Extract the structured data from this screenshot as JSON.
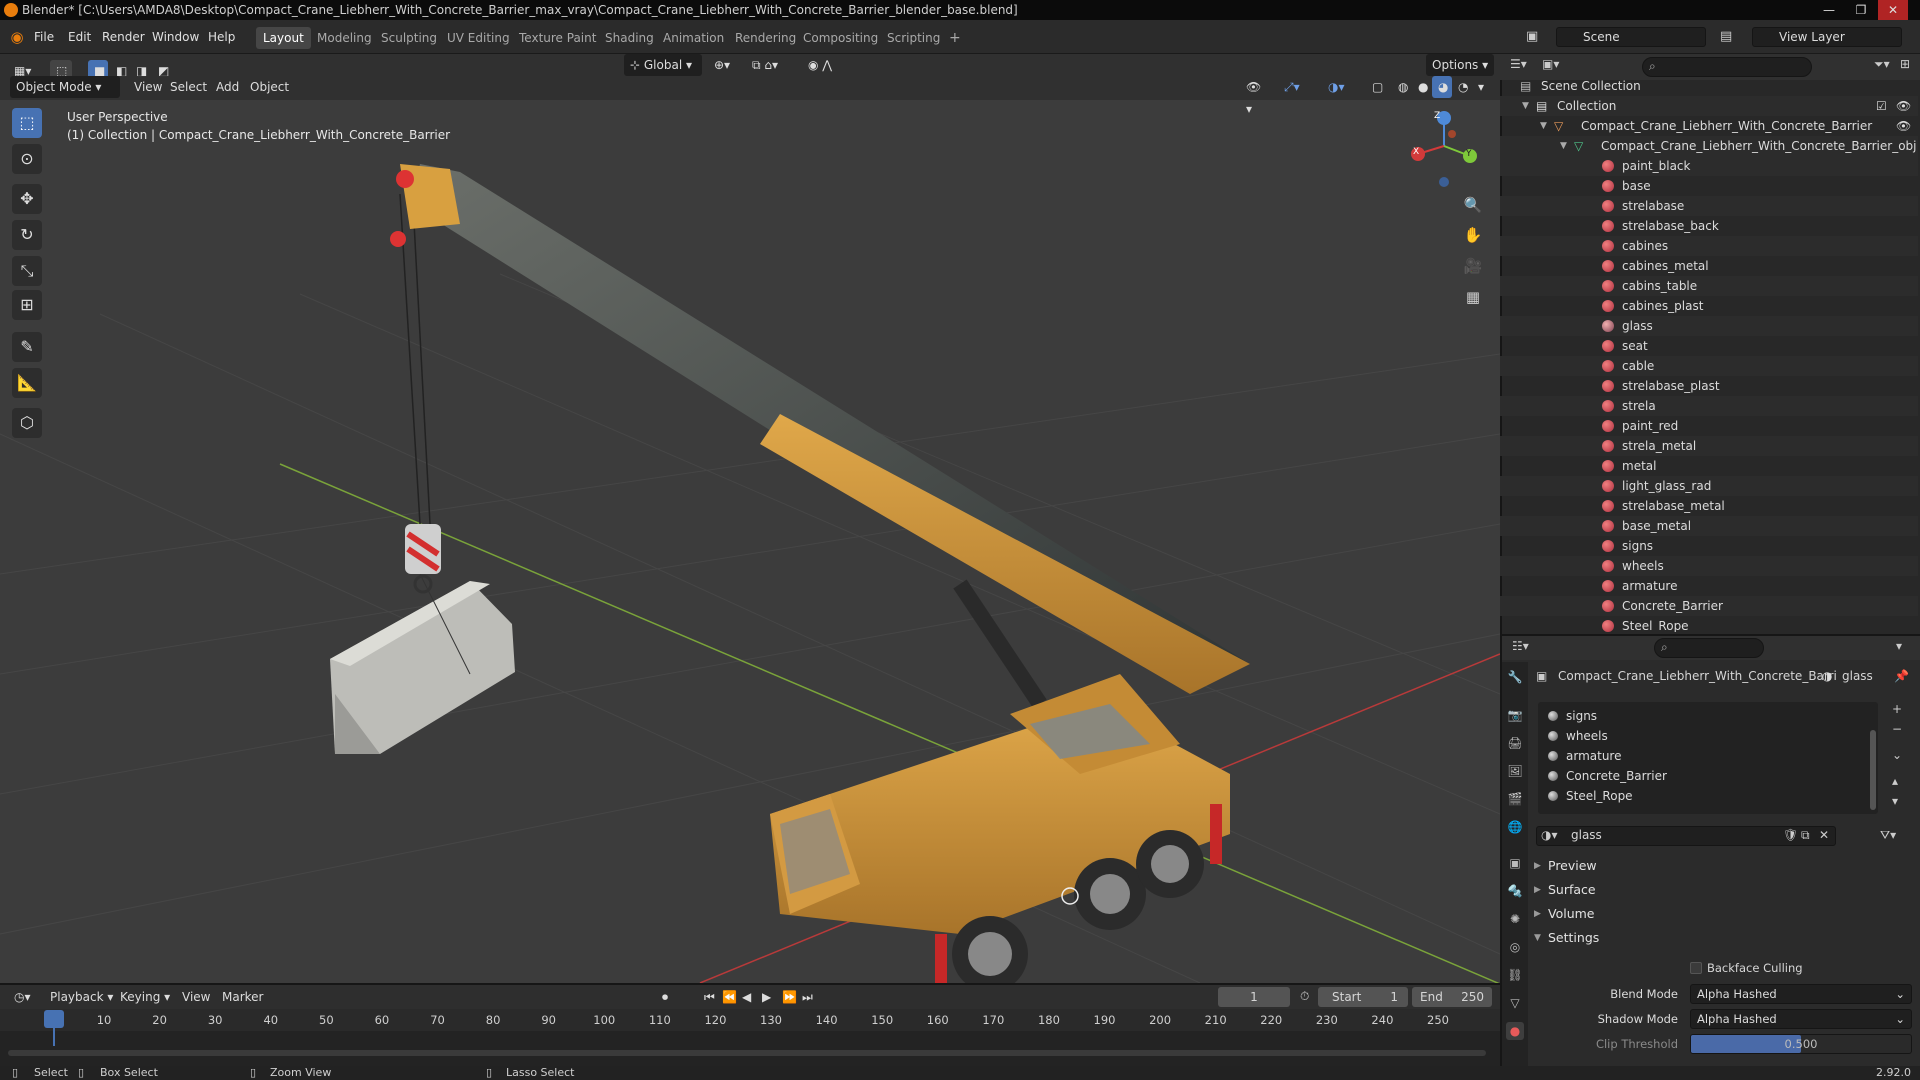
{
  "window": {
    "title": "Blender* [C:\\Users\\AMDA8\\Desktop\\Compact_Crane_Liebherr_With_Concrete_Barrier_max_vray\\Compact_Crane_Liebherr_With_Concrete_Barrier_blender_base.blend]",
    "controls": [
      "—",
      "❐",
      "✕"
    ]
  },
  "menu": {
    "items": [
      "File",
      "Edit",
      "Render",
      "Window",
      "Help"
    ],
    "workspaces": [
      "Layout",
      "Modeling",
      "Sculpting",
      "UV Editing",
      "Texture Paint",
      "Shading",
      "Animation",
      "Rendering",
      "Compositing",
      "Scripting"
    ],
    "active_workspace": "Layout",
    "add_workspace": "+",
    "scene": "Scene",
    "view_layer": "View Layer"
  },
  "viewport": {
    "mode": "Object Mode",
    "menu": [
      "View",
      "Select",
      "Add",
      "Object"
    ],
    "transform_orientation": "Global",
    "options": "Options",
    "info_line1": "User Perspective",
    "info_line2": "(1) Collection | Compact_Crane_Liebherr_With_Concrete_Barrier",
    "gizmo": {
      "x": "X",
      "y": "Y",
      "z": "Z"
    }
  },
  "outliner": {
    "search_placeholder": "",
    "scene_collection": "Scene Collection",
    "collection": "Collection",
    "object": "Compact_Crane_Liebherr_With_Concrete_Barrier",
    "mesh": "Compact_Crane_Liebherr_With_Concrete_Barrier_obj",
    "materials": [
      "paint_black",
      "base",
      "strelabase",
      "strelabase_back",
      "cabines",
      "cabines_metal",
      "cabins_table",
      "cabines_plast",
      "glass",
      "seat",
      "cable",
      "strelabase_plast",
      "strela",
      "paint_red",
      "strela_metal",
      "metal",
      "light_glass_rad",
      "strelabase_metal",
      "base_metal",
      "signs",
      "wheels",
      "armature",
      "Concrete_Barrier",
      "Steel_Rope"
    ]
  },
  "properties": {
    "breadcrumb_object": "Compact_Crane_Liebherr_With_Concrete_Barri...",
    "breadcrumb_material": "glass",
    "slots": [
      "signs",
      "wheels",
      "armature",
      "Concrete_Barrier",
      "Steel_Rope"
    ],
    "material_name": "glass",
    "panels": [
      "Preview",
      "Surface",
      "Volume",
      "Settings"
    ],
    "backface_culling_label": "Backface Culling",
    "blend_mode_label": "Blend Mode",
    "blend_mode_value": "Alpha Hashed",
    "shadow_mode_label": "Shadow Mode",
    "shadow_mode_value": "Alpha Hashed",
    "clip_threshold_label": "Clip Threshold",
    "clip_threshold_value": "0.500"
  },
  "timeline": {
    "menus": [
      "Playback",
      "Keying",
      "View",
      "Marker"
    ],
    "current_frame": "1",
    "start_label": "Start",
    "start_value": "1",
    "end_label": "End",
    "end_value": "250",
    "ticks": [
      "1",
      "10",
      "20",
      "30",
      "40",
      "50",
      "60",
      "70",
      "80",
      "90",
      "100",
      "110",
      "120",
      "130",
      "140",
      "150",
      "160",
      "170",
      "180",
      "190",
      "200",
      "210",
      "220",
      "230",
      "240",
      "250"
    ]
  },
  "statusbar": {
    "select": "Select",
    "box_select": "Box Select",
    "zoom_view": "Zoom View",
    "lasso_select": "Lasso Select",
    "version": "2.92.0"
  },
  "colors": {
    "accent": "#4772b3",
    "crane_yellow": "#d19a3a",
    "axis_x": "#d33a3a",
    "axis_y": "#7ec93a"
  }
}
